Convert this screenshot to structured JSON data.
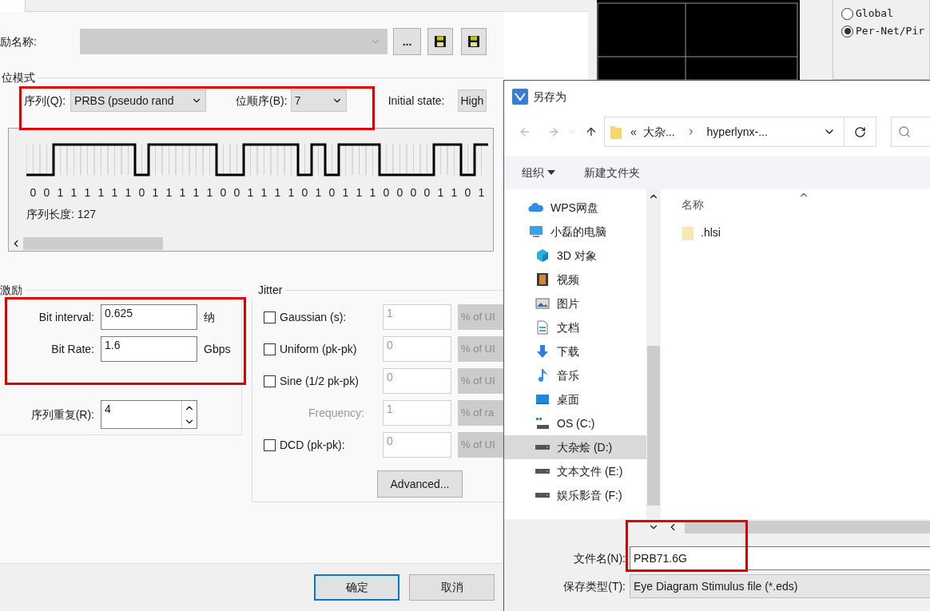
{
  "main_dialog": {
    "name_row": {
      "label": "励名称:",
      "browse_button": "..."
    },
    "bit_pattern": {
      "title": "位模式",
      "sequence_label": "序列(Q):",
      "sequence_value": "PRBS (pseudo rand",
      "order_label": "位顺序(B):",
      "order_value": "7",
      "initial_state_label": "Initial state:",
      "initial_state_value": "High",
      "bits": [
        "0",
        "0",
        "1",
        "1",
        "1",
        "1",
        "1",
        "1",
        "0",
        "1",
        "1",
        "1",
        "1",
        "1",
        "0",
        "0",
        "1",
        "1",
        "1",
        "1",
        "0",
        "1",
        "0",
        "1",
        "1",
        "1",
        "0",
        "0",
        "0",
        "0",
        "1",
        "1",
        "0",
        "1"
      ],
      "length_label": "序列长度: 127"
    },
    "stimulus": {
      "title": "激励",
      "fields": [
        {
          "label": "Bit interval:",
          "value": "0.625",
          "unit": "纳"
        },
        {
          "label": "Bit Rate:",
          "value": "1.6",
          "unit": "Gbps"
        }
      ],
      "repeat_label": "序列重复(R):",
      "repeat_value": "4"
    },
    "jitter": {
      "title": "Jitter",
      "rows": [
        {
          "kind": "checkbox",
          "label": "Gaussian (s):",
          "checked": false,
          "value": "1",
          "unit": "% of UI"
        },
        {
          "kind": "checkbox",
          "label": "Uniform (pk-pk)",
          "checked": false,
          "value": "0",
          "unit": "% of UI"
        },
        {
          "kind": "checkbox",
          "label": "Sine (1/2 pk-pk)",
          "checked": false,
          "value": "0",
          "unit": "% of UI"
        },
        {
          "kind": "plain",
          "label": "Frequency:",
          "value": "1",
          "unit": "% of ra"
        },
        {
          "kind": "checkbox",
          "label": "DCD (pk-pk):",
          "checked": false,
          "value": "0",
          "unit": "% of UI"
        }
      ],
      "advanced_button": "Advanced..."
    },
    "buttons": [
      {
        "label": "确定",
        "default": true
      },
      {
        "label": "取消",
        "default": false
      }
    ]
  },
  "background_window": {
    "radios": [
      {
        "label": "Global",
        "selected": false
      },
      {
        "label": "Per-Net/Pir",
        "selected": true
      }
    ]
  },
  "save_dialog": {
    "title": "另存为",
    "path_prefix": "«",
    "path": [
      "大杂...",
      "hyperlynx-..."
    ],
    "toolbar": {
      "organize": "组织",
      "new_folder": "新建文件夹"
    },
    "sidebar": [
      {
        "kind": "cloud",
        "label": "WPS网盘",
        "selected": false
      },
      {
        "kind": "computer",
        "label": "小磊的电脑",
        "selected": false,
        "children": [
          {
            "kind": "cube",
            "label": "3D 对象",
            "selected": false
          },
          {
            "kind": "video",
            "label": "视频",
            "selected": false
          },
          {
            "kind": "image",
            "label": "图片",
            "selected": false
          },
          {
            "kind": "document",
            "label": "文档",
            "selected": false
          },
          {
            "kind": "download",
            "label": "下载",
            "selected": false
          },
          {
            "kind": "music",
            "label": "音乐",
            "selected": false
          },
          {
            "kind": "desktop",
            "label": "桌面",
            "selected": false
          },
          {
            "kind": "system_drive",
            "label": "OS (C:)",
            "selected": false
          },
          {
            "kind": "drive",
            "label": "大杂烩 (D:)",
            "selected": true
          },
          {
            "kind": "drive",
            "label": "文本文件 (E:)",
            "selected": false
          },
          {
            "kind": "drive",
            "label": "娱乐影音 (F:)",
            "selected": false
          }
        ]
      }
    ],
    "column_header": "名称",
    "files": [
      {
        "name": ".hlsi"
      }
    ],
    "filename_label": "文件名(N):",
    "filename_value": "PRB71.6G",
    "type_label": "保存类型(T):",
    "type_value": "Eye Diagram Stimulus file (*.eds)"
  }
}
